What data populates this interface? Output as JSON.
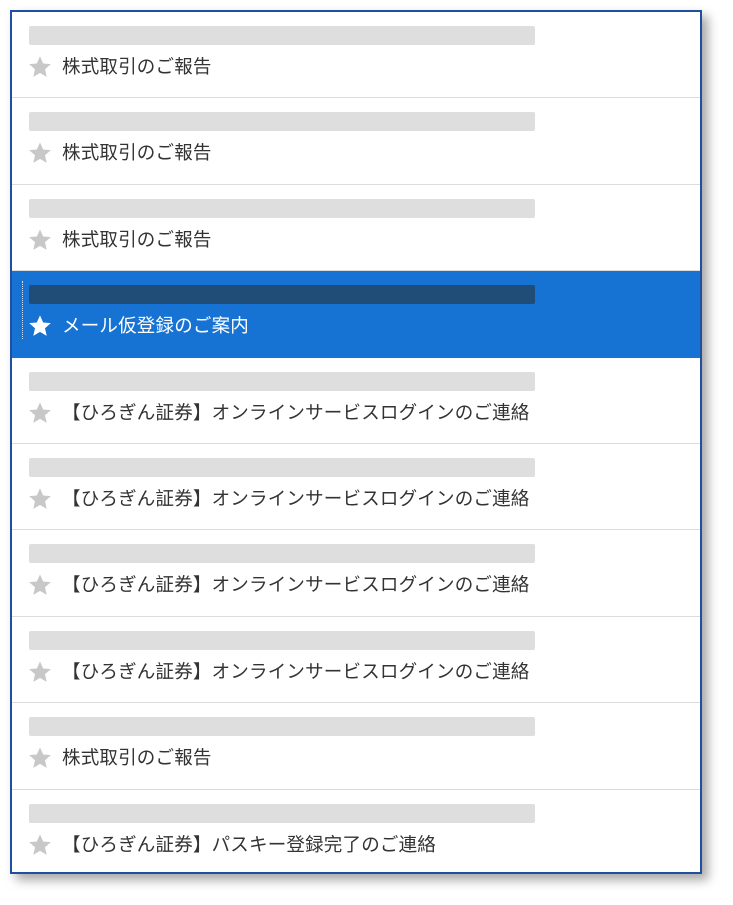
{
  "colors": {
    "frame_border": "#1f4fa0",
    "selected_background": "#1673d3",
    "star_inactive": "#c8c8c8",
    "text": "#333333"
  },
  "mail_list": {
    "selected_index": 3,
    "items": [
      {
        "subject": "株式取引のご報告",
        "starred": false,
        "selected": false
      },
      {
        "subject": "株式取引のご報告",
        "starred": false,
        "selected": false
      },
      {
        "subject": "株式取引のご報告",
        "starred": false,
        "selected": false
      },
      {
        "subject": "メール仮登録のご案内",
        "starred": false,
        "selected": true
      },
      {
        "subject": "【ひろぎん証券】オンラインサービスログインのご連絡",
        "starred": false,
        "selected": false
      },
      {
        "subject": "【ひろぎん証券】オンラインサービスログインのご連絡",
        "starred": false,
        "selected": false
      },
      {
        "subject": "【ひろぎん証券】オンラインサービスログインのご連絡",
        "starred": false,
        "selected": false
      },
      {
        "subject": "【ひろぎん証券】オンラインサービスログインのご連絡",
        "starred": false,
        "selected": false
      },
      {
        "subject": "株式取引のご報告",
        "starred": false,
        "selected": false
      },
      {
        "subject": "【ひろぎん証券】パスキー登録完了のご連絡",
        "starred": false,
        "selected": false
      }
    ]
  }
}
